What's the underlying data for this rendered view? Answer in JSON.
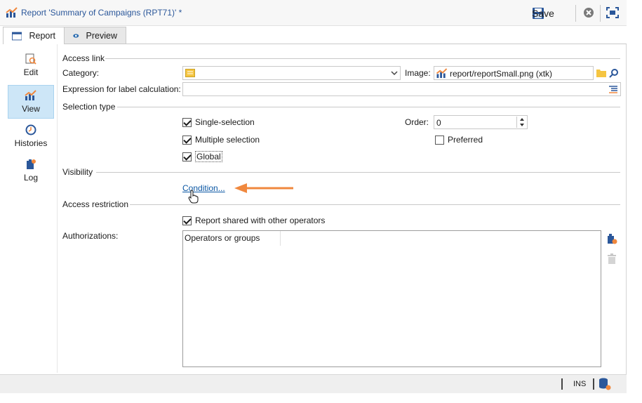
{
  "window": {
    "title": "Report 'Summary of Campaigns (RPT71)' *",
    "toolbar": {
      "save_label": "Save"
    }
  },
  "tabs": [
    {
      "label": "Report",
      "active": true,
      "icon": "report-tab-icon"
    },
    {
      "label": "Preview",
      "active": false,
      "icon": "eye-icon"
    }
  ],
  "leftnav": {
    "items": [
      {
        "label": "Edit",
        "icon": "edit-icon"
      },
      {
        "label": "View",
        "icon": "chart-icon",
        "selected": true
      },
      {
        "label": "Histories",
        "icon": "clock-icon"
      },
      {
        "label": "Log",
        "icon": "log-icon"
      }
    ]
  },
  "form": {
    "access_link": {
      "title": "Access link",
      "category_label": "Category:",
      "category_value": "",
      "image_label": "Image:",
      "image_value": "report/reportSmall.png (xtk)",
      "expression_label": "Expression for label calculation:",
      "expression_value": ""
    },
    "selection_type": {
      "title": "Selection type",
      "single_selection": {
        "label": "Single-selection",
        "checked": true
      },
      "multiple_selection": {
        "label": "Multiple selection",
        "checked": true
      },
      "global": {
        "label": "Global",
        "checked": true
      },
      "order_label": "Order:",
      "order_value": "0",
      "preferred": {
        "label": "Preferred",
        "checked": false
      }
    },
    "visibility": {
      "title": "Visibility",
      "condition_link": "Condition..."
    },
    "access_restriction": {
      "title": "Access restriction",
      "shared": {
        "label": "Report shared with other operators",
        "checked": true
      },
      "authorizations_label": "Authorizations:",
      "grid_header": "Operators or groups",
      "rows": []
    }
  },
  "statusbar": {
    "mode": "INS"
  },
  "colors": {
    "accent": "#2b579a",
    "arrow": "#f0883e",
    "selected_nav": "#cde6f7"
  }
}
